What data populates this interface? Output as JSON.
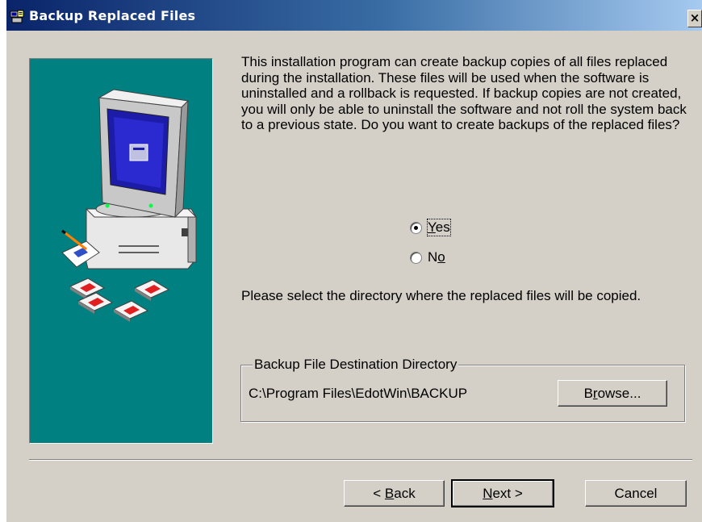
{
  "window": {
    "title": "Backup Replaced Files",
    "close_glyph": "×",
    "icon": "setup-icon"
  },
  "illustration": {
    "icon": "computer-illustration",
    "accent_color": "#008080"
  },
  "intro_text": "This installation program can create backup copies of all files replaced during the installation. These files will be used when the software is uninstalled and a rollback is requested.  If backup copies are not created, you will only be able to uninstall the software and not roll the system back to a previous state. Do you want to create backups of the replaced files?",
  "options": {
    "yes": {
      "label_prefix": "",
      "label_hotkey": "Y",
      "label_rest": "es",
      "checked": true
    },
    "no": {
      "label_prefix": "N",
      "label_hotkey": "o",
      "label_rest": "",
      "checked": false
    }
  },
  "select_text": "Please select the directory where the replaced  files will be copied.",
  "destination": {
    "legend": "Backup File Destination Directory",
    "path": "C:\\Program Files\\EdotWin\\BACKUP",
    "browse_prefix": "B",
    "browse_hotkey": "r",
    "browse_rest": "owse..."
  },
  "buttons": {
    "back_prefix": "< ",
    "back_hotkey": "B",
    "back_rest": "ack",
    "next_hotkey": "N",
    "next_rest": "ext >",
    "cancel": "Cancel"
  }
}
